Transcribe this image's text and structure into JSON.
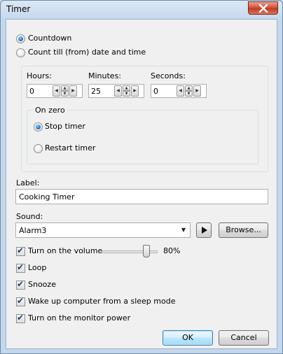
{
  "window": {
    "title": "Timer"
  },
  "mode": {
    "countdown_label": "Countdown",
    "count_till_label": "Count till (from) date and time",
    "selected": "countdown"
  },
  "time": {
    "hours_label": "Hours:",
    "hours_value": "0",
    "minutes_label": "Minutes:",
    "minutes_value": "25",
    "seconds_label": "Seconds:",
    "seconds_value": "0"
  },
  "on_zero": {
    "legend": "On zero",
    "stop_label": "Stop timer",
    "restart_label": "Restart timer",
    "selected": "stop"
  },
  "label_field": {
    "label": "Label:",
    "value": "Cooking Timer"
  },
  "sound": {
    "label": "Sound:",
    "selected": "Alarm3",
    "browse_label": "Browse..."
  },
  "options": {
    "volume_label": "Turn on the volume",
    "volume_percent": 80,
    "volume_text": "80%",
    "loop_label": "Loop",
    "snooze_label": "Snooze",
    "wake_label": "Wake up computer from a sleep mode",
    "monitor_label": "Turn on the monitor power",
    "checked": {
      "volume": true,
      "loop": true,
      "snooze": true,
      "wake": true,
      "monitor": true
    }
  },
  "footer": {
    "ok_label": "OK",
    "cancel_label": "Cancel"
  },
  "colors": {
    "default_button_border": "#3c7fb1",
    "close_button": "#c0381d",
    "radio_dot": "#1b64b5"
  }
}
